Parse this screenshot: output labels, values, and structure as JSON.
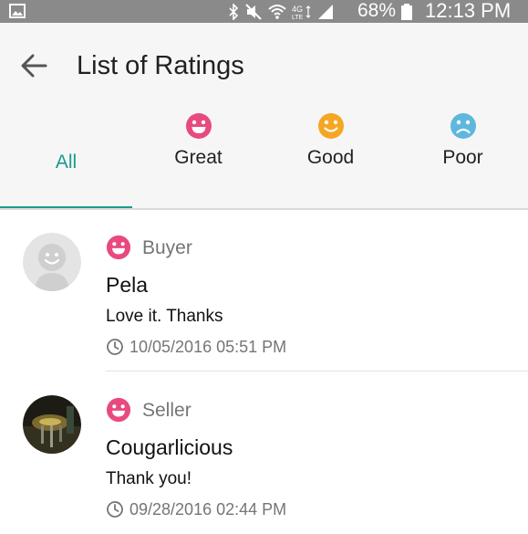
{
  "status_bar": {
    "battery": "68%",
    "time": "12:13 PM"
  },
  "header": {
    "title": "List of Ratings"
  },
  "tabs": [
    {
      "label": "All",
      "icon": null,
      "active": true
    },
    {
      "label": "Great",
      "icon": "happy-face-icon",
      "color": "#e84a7f"
    },
    {
      "label": "Good",
      "icon": "smile-face-icon",
      "color": "#f5a623"
    },
    {
      "label": "Poor",
      "icon": "sad-face-icon",
      "color": "#5fb7de"
    }
  ],
  "ratings": [
    {
      "role": "Buyer",
      "name": "Pela",
      "comment": "Love it. Thanks",
      "timestamp": "10/05/2016 05:51 PM",
      "rating_icon": "happy-face-icon",
      "avatar": "default-avatar"
    },
    {
      "role": "Seller",
      "name": "Cougarlicious",
      "comment": "Thank you!",
      "timestamp": "09/28/2016 02:44 PM",
      "rating_icon": "happy-face-icon",
      "avatar": "photo-avatar"
    }
  ],
  "colors": {
    "accent": "#1a9b8c",
    "great": "#e84a7f",
    "good": "#f5a623",
    "poor": "#5fb7de",
    "status_bar": "#8a8a8a"
  }
}
